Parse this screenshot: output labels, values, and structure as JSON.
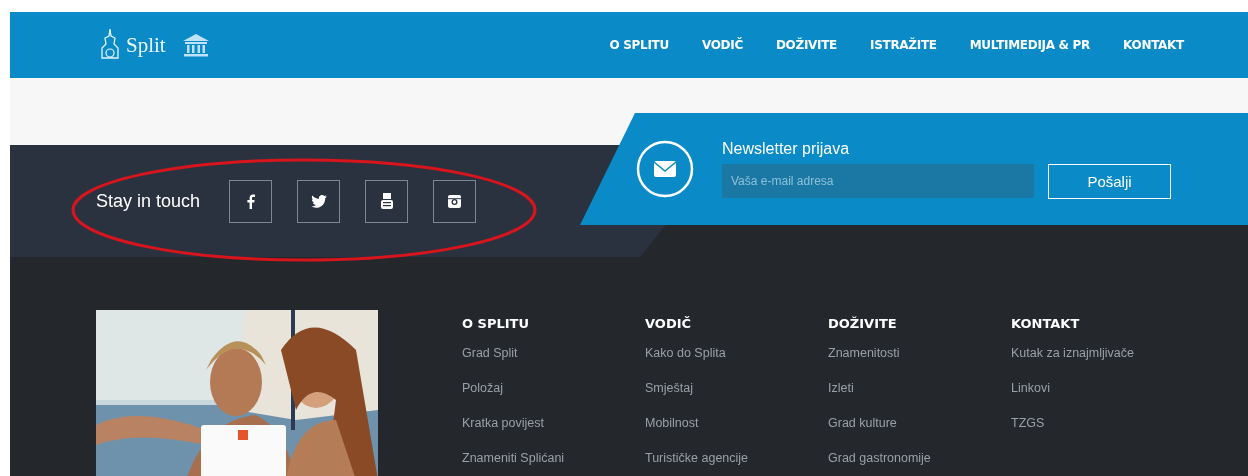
{
  "header": {
    "logo_text": "Split",
    "nav": [
      {
        "label": "O SPLITU"
      },
      {
        "label": "VODIČ"
      },
      {
        "label": "DOŽIVITE"
      },
      {
        "label": "ISTRAŽITE"
      },
      {
        "label": "MULTIMEDIJA & PR"
      },
      {
        "label": "KONTAKT"
      }
    ]
  },
  "stay_in_touch": {
    "label": "Stay in touch",
    "social": [
      {
        "kind": "facebook"
      },
      {
        "kind": "twitter"
      },
      {
        "kind": "youtube"
      },
      {
        "kind": "instagram"
      }
    ],
    "highlighted": true
  },
  "newsletter": {
    "title": "Newsletter prijava",
    "placeholder": "Vaša e-mail adresa",
    "button": "Pošalji"
  },
  "footer": {
    "columns": [
      {
        "heading": "O SPLITU",
        "links": [
          "Grad Split",
          "Položaj",
          "Kratka povijest",
          "Znameniti Splićani"
        ]
      },
      {
        "heading": "VODIČ",
        "links": [
          "Kako do Splita",
          "Smještaj",
          "Mobilnost",
          "Turističke agencije"
        ]
      },
      {
        "heading": "DOŽIVITE",
        "links": [
          "Znamenitosti",
          "Izleti",
          "Grad kulture",
          "Grad gastronomije"
        ]
      },
      {
        "heading": "KONTAKT",
        "links": [
          "Kutak za iznajmljivače",
          "Linkovi",
          "TZGS"
        ]
      }
    ]
  }
}
